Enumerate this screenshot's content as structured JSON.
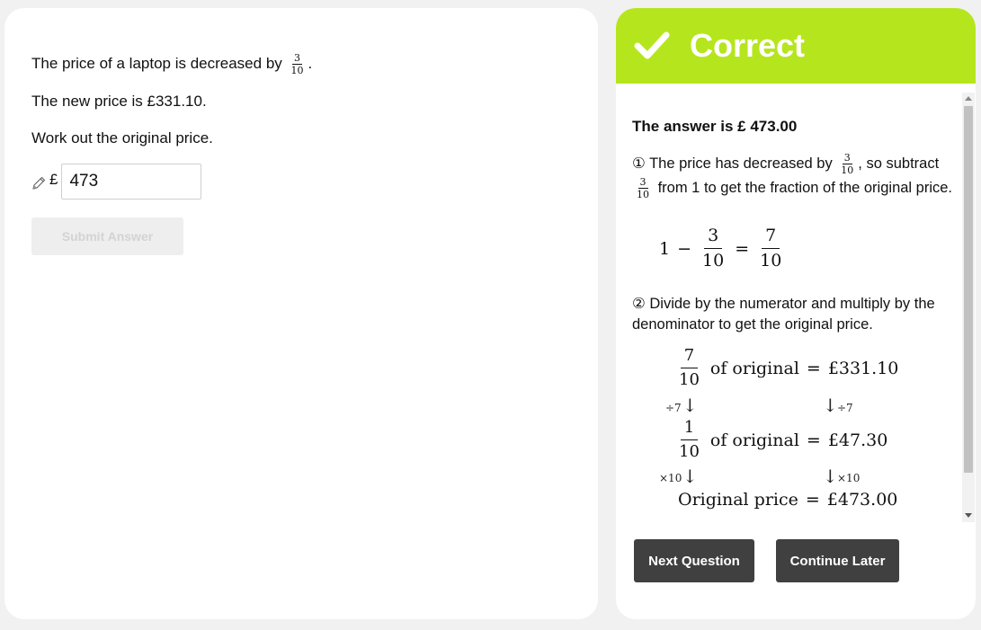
{
  "question": {
    "line1_text": "The price of a laptop is decreased by",
    "fraction": {
      "num": "3",
      "den": "10"
    },
    "line1_end": ".",
    "line2": "The new price is £331.10.",
    "line3": "Work out the original price.",
    "currency_symbol": "£",
    "answer_value": "473",
    "submit_label": "Submit Answer"
  },
  "feedback": {
    "status": "Correct",
    "accent_color": "#b5e61d",
    "answer_heading": "The answer is £ 473.00",
    "step1": {
      "text_a": "① The price has decreased by",
      "text_b": ", so subtract",
      "text_c": "from 1 to get the fraction of the original price.",
      "fraction": {
        "num": "3",
        "den": "10"
      }
    },
    "equation1": {
      "left": "1",
      "minus": "−",
      "frac1": {
        "num": "3",
        "den": "10"
      },
      "equals": "=",
      "frac2": {
        "num": "7",
        "den": "10"
      }
    },
    "step2": {
      "text": "② Divide by the numerator and multiply by the denominator to get the original price."
    },
    "calculation": {
      "row1": {
        "num": "7",
        "den": "10",
        "text": "of original",
        "equals": "=",
        "value": "£331.10"
      },
      "op1": "÷7",
      "row2": {
        "num": "1",
        "den": "10",
        "text": "of original",
        "equals": "=",
        "value": "£47.30"
      },
      "op2": "×10",
      "row3": {
        "text": "Original price",
        "equals": "=",
        "value": "£473.00"
      },
      "arrow": "↓"
    },
    "next_label": "Next Question",
    "continue_label": "Continue Later"
  }
}
